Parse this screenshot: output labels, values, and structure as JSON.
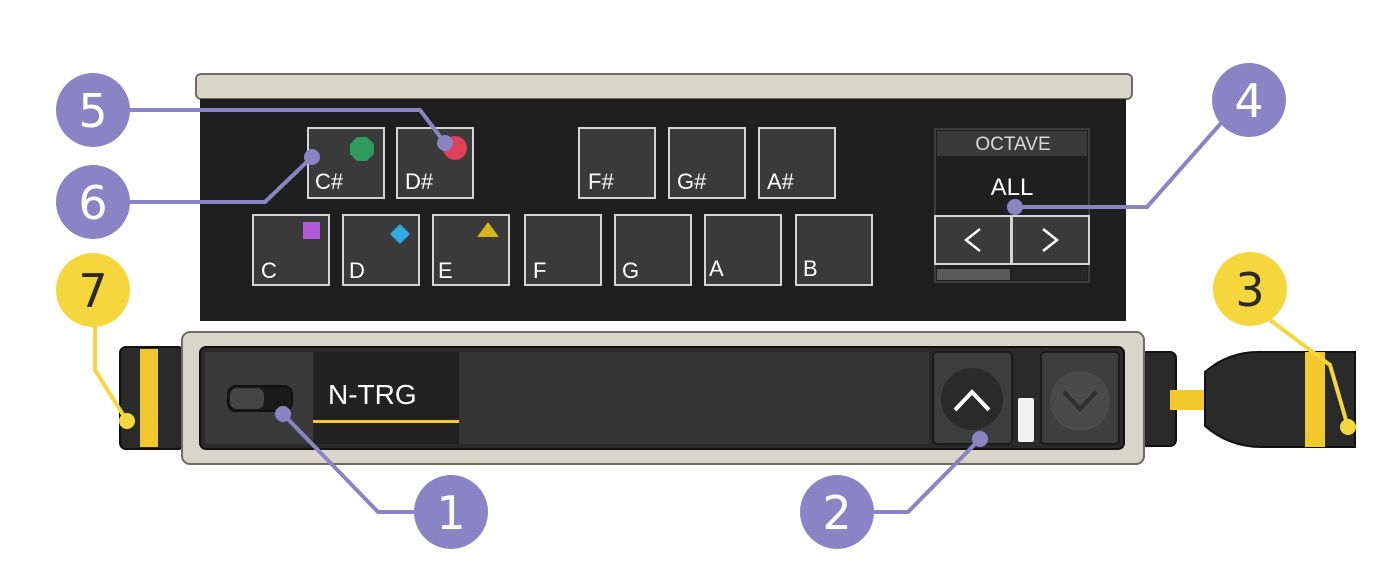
{
  "keyboard": {
    "black_keys": [
      "C#",
      "D#",
      "F#",
      "G#",
      "A#"
    ],
    "white_keys": [
      "C",
      "D",
      "E",
      "F",
      "G",
      "A",
      "B"
    ],
    "markers": {
      "C#": {
        "shape": "octagon",
        "color": "#2e9a5e"
      },
      "D#": {
        "shape": "circle",
        "color": "#e0405a"
      },
      "C": {
        "shape": "square",
        "color": "#b35ad6"
      },
      "D": {
        "shape": "diamond",
        "color": "#2fa9e0"
      },
      "E": {
        "shape": "triangle",
        "color": "#d6b321"
      }
    }
  },
  "octave": {
    "header": "OCTAVE",
    "value": "ALL",
    "prev_label": "<",
    "next_label": ">"
  },
  "module": {
    "mode_label": "N-TRG",
    "toggle_icon": "switch-icon",
    "up_icon": "chevron-up-icon",
    "down_icon": "chevron-down-icon"
  },
  "callouts": [
    "1",
    "2",
    "3",
    "4",
    "5",
    "6",
    "7"
  ],
  "colors": {
    "callout_purple": "#8a84c4",
    "callout_yellow": "#f5d63d",
    "panel_dark": "#1f1f1f",
    "key_fill": "#3a3a3a",
    "key_border": "#d4d4d4",
    "frame_beige": "#d8d6c8",
    "accent_yellow": "#f2c92c"
  }
}
